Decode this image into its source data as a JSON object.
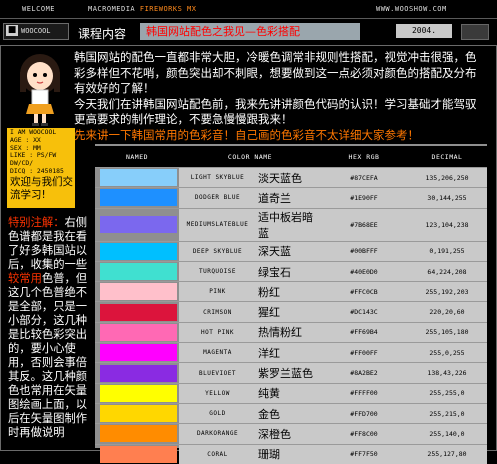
{
  "top_nav": {
    "welcome": "WELCOME",
    "product": "MACROMEDIA",
    "product_accent": "FIREWORKS MX",
    "site": "WWW.WOOSHOW.COM"
  },
  "header": {
    "logo": "WOOCOOL",
    "section": "课程内容",
    "title": "韩国网站配色之我见—色彩搭配",
    "year": "2004."
  },
  "intro": {
    "para1": "韩国网站的配色一直都非常大胆，冷暖色调常非规则性搭配，视觉冲击很强，色彩多样但不花哨，颜色突出却不刺眼，想要做到这一点必须对颜色的搭配及分布有效好的了解！",
    "para2": "今天我们在讲韩国网站配色前，我来先讲讲颜色代码的认识！学习基础才能驾驭更高要求的制作理论，不要急慢慢跟我来！",
    "para3": "先来讲一下韩国常用的色彩音！自己画的色彩音不太详细大家参考！"
  },
  "profile": {
    "lines": [
      "I AM WOOCOOL",
      "AGE : XX",
      "SEX : MM",
      "LIKE : PS/FW",
      "DW/CD/",
      "DICQ : 2450185"
    ],
    "welcome": "欢迎与我们交流学习!"
  },
  "sidebar": {
    "heading": "特别注解：",
    "text_a": "右侧色谱都是我在看了好多韩国站以后，收集的一些",
    "highlight": "较常用",
    "text_b": "色普，但这几个色普绝不是全部，只是一小部分，这几种是比较色彩突出的，要小心使用，否则会事倍其反。这几种颜色也常用在矢量图绘画上面，以后在矢量图制作时再做说明"
  },
  "table": {
    "headers": [
      "NAMED",
      "COLOR NAME",
      "HEX RGB",
      "DECIMAL"
    ],
    "rows": [
      {
        "en": "LIGHT SKYBLUE",
        "zh": "淡天蓝色",
        "hex": "#87CEFA",
        "dec": "135,206,250",
        "color": "#87CEFA"
      },
      {
        "en": "DODGER BLUE",
        "zh": "道奇兰",
        "hex": "#1E90FF",
        "dec": "30,144,255",
        "color": "#1E90FF"
      },
      {
        "en": "MEDIUMSLATEBLUE",
        "zh": "适中板岩暗蓝",
        "hex": "#7B68EE",
        "dec": "123,104,238",
        "color": "#7B68EE"
      },
      {
        "en": "DEEP SKYBLUE",
        "zh": "深天蓝",
        "hex": "#00BFFF",
        "dec": "0,191,255",
        "color": "#00BFFF"
      },
      {
        "en": "TURQUOISE",
        "zh": "绿宝石",
        "hex": "#40E0D0",
        "dec": "64,224,208",
        "color": "#40E0D0"
      },
      {
        "en": "PINK",
        "zh": "粉红",
        "hex": "#FFC0CB",
        "dec": "255,192,203",
        "color": "#FFC0CB"
      },
      {
        "en": "CRIMSON",
        "zh": "猩红",
        "hex": "#DC143C",
        "dec": "220,20,60",
        "color": "#DC143C"
      },
      {
        "en": "HOT PINK",
        "zh": "热情粉红",
        "hex": "#FF69B4",
        "dec": "255,105,180",
        "color": "#FF69B4"
      },
      {
        "en": "MAGENTA",
        "zh": "洋红",
        "hex": "#FF00FF",
        "dec": "255,0,255",
        "color": "#FF00FF"
      },
      {
        "en": "BLUEVIOET",
        "zh": "紫罗兰蓝色",
        "hex": "#8A2BE2",
        "dec": "138,43,226",
        "color": "#8A2BE2"
      },
      {
        "en": "YELLOW",
        "zh": "纯黄",
        "hex": "#FFFF00",
        "dec": "255,255,0",
        "color": "#FFFF00"
      },
      {
        "en": "GOLD",
        "zh": "金色",
        "hex": "#FFD700",
        "dec": "255,215,0",
        "color": "#FFD700"
      },
      {
        "en": "DARKORANGE",
        "zh": "深橙色",
        "hex": "#FF8C00",
        "dec": "255,140,0",
        "color": "#FF8C00"
      },
      {
        "en": "CORAL",
        "zh": "珊瑚",
        "hex": "#FF7F50",
        "dec": "255,127,80",
        "color": "#FF7F50"
      }
    ]
  }
}
